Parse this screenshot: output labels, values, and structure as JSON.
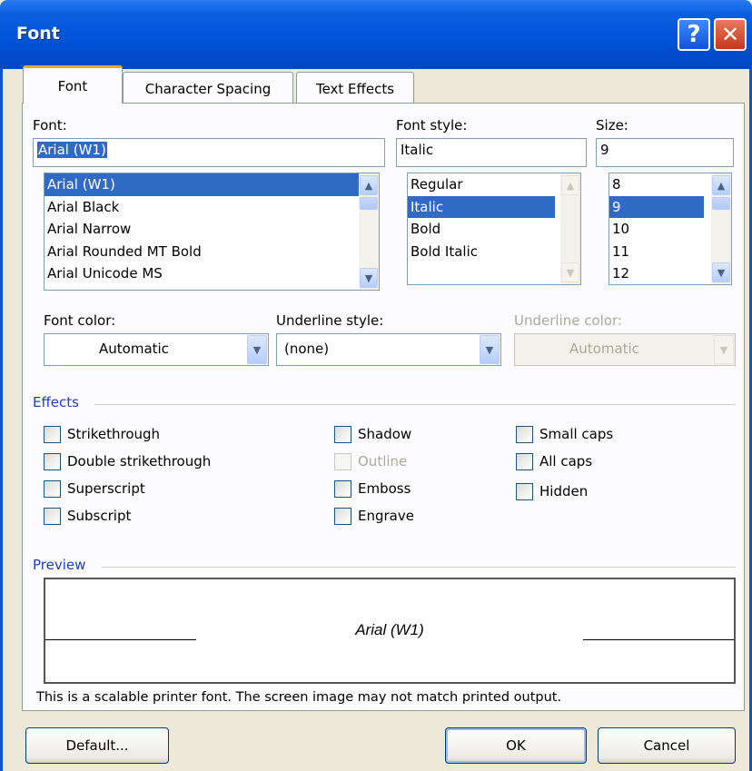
{
  "window": {
    "title": "Font",
    "help_glyph": "?",
    "close_glyph": "✕"
  },
  "tabs": [
    {
      "label": "Font"
    },
    {
      "label": "Character Spacing"
    },
    {
      "label": "Text Effects"
    }
  ],
  "font": {
    "label": "Font:",
    "value": "Arial (W1)",
    "items": [
      "Arial (W1)",
      "Arial Black",
      "Arial Narrow",
      "Arial Rounded MT Bold",
      "Arial Unicode MS"
    ],
    "selected_index": 0
  },
  "font_style": {
    "label": "Font style:",
    "value": "Italic",
    "items": [
      "Regular",
      "Italic",
      "Bold",
      "Bold Italic"
    ],
    "selected_index": 1
  },
  "size": {
    "label": "Size:",
    "value": "9",
    "items": [
      "8",
      "9",
      "10",
      "11",
      "12"
    ],
    "selected_index": 1
  },
  "font_color": {
    "label": "Font color:",
    "value": "Automatic"
  },
  "underline_style": {
    "label": "Underline style:",
    "value": "(none)"
  },
  "underline_color": {
    "label": "Underline color:",
    "value": "Automatic",
    "enabled": false
  },
  "effects": {
    "title": "Effects",
    "col1": [
      "Strikethrough",
      "Double strikethrough",
      "Superscript",
      "Subscript"
    ],
    "col2": [
      "Shadow",
      "Outline",
      "Emboss",
      "Engrave"
    ],
    "col3": [
      "Small caps",
      "All caps",
      "Hidden"
    ]
  },
  "preview": {
    "title": "Preview",
    "sample": "Arial (W1)",
    "note": "This is a scalable printer font. The screen image may not match printed output."
  },
  "buttons": {
    "default": "Default...",
    "ok": "OK",
    "cancel": "Cancel"
  },
  "icons": {
    "scroll_up": "up-arrow-icon",
    "scroll_down": "down-arrow-icon",
    "dropdown": "chevron-down-icon"
  },
  "colors": {
    "title_bar": "#0052d6",
    "selection": "#316ac5",
    "tab_accent": "#f5a623",
    "dialog_bg": "#ece9d8"
  }
}
